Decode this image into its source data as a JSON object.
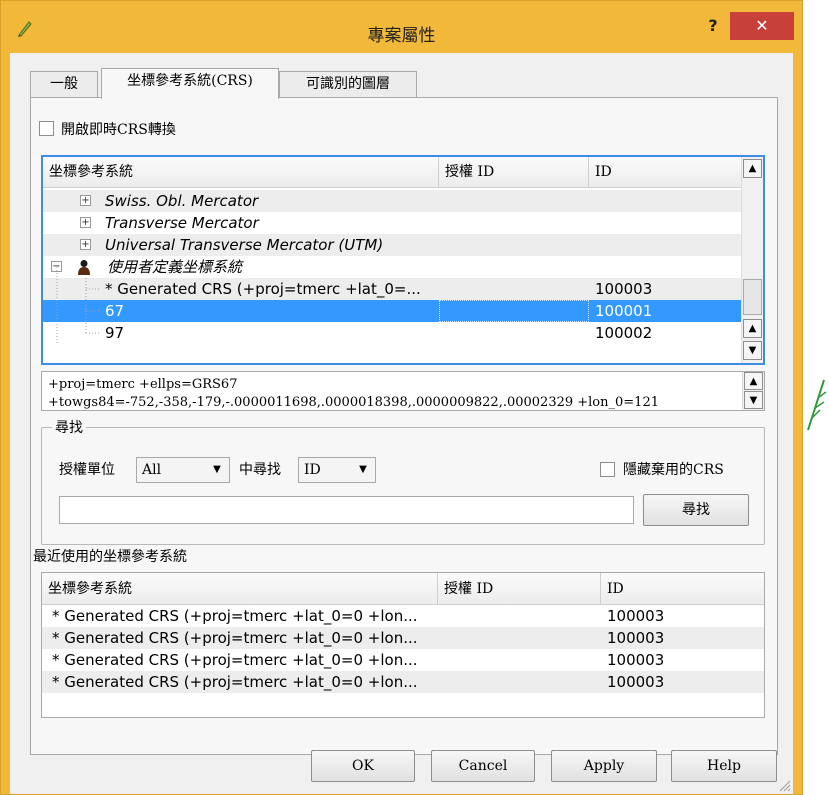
{
  "window": {
    "title": "專案屬性",
    "help_label": "?",
    "close_label": "✕"
  },
  "tabs": [
    {
      "label": "一般",
      "active": false
    },
    {
      "label": "坐標參考系統(CRS)",
      "active": true
    },
    {
      "label": "可識別的圖層",
      "active": false
    }
  ],
  "crs_tab": {
    "otf_checkbox_label": "開啟即時CRS轉換",
    "otf_checked": false,
    "tree": {
      "columns": [
        "坐標參考系統",
        "授權 ID",
        "ID"
      ],
      "rows": [
        {
          "name": "Swiss. Obl. Mercator",
          "auth_id": "",
          "id": "",
          "level": 2,
          "expander": "+",
          "italic": true,
          "selected": false
        },
        {
          "name": "Transverse Mercator",
          "auth_id": "",
          "id": "",
          "level": 2,
          "expander": "+",
          "italic": true,
          "selected": false
        },
        {
          "name": "Universal Transverse Mercator (UTM)",
          "auth_id": "",
          "id": "",
          "level": 2,
          "expander": "+",
          "italic": true,
          "selected": false
        },
        {
          "name": "使用者定義坐標系統",
          "auth_id": "",
          "id": "",
          "level": 1,
          "expander": "−",
          "italic": true,
          "selected": false,
          "user_icon": true
        },
        {
          "name": "* Generated CRS (+proj=tmerc +lat_0=...",
          "auth_id": "",
          "id": "100003",
          "level": 3,
          "expander": "",
          "italic": false,
          "selected": false
        },
        {
          "name": "67",
          "auth_id": "",
          "id": "100001",
          "level": 3,
          "expander": "",
          "italic": false,
          "selected": true
        },
        {
          "name": "97",
          "auth_id": "",
          "id": "100002",
          "level": 3,
          "expander": "",
          "italic": false,
          "selected": false
        }
      ]
    },
    "proj_text": {
      "line1": "+proj=tmerc +ellps=GRS67",
      "line2": "+towgs84=-752,-358,-179,-.0000011698,.0000018398,.0000009822,.00002329 +lon_0=121"
    },
    "search": {
      "group_title": "尋找",
      "authority_label": "授權單位",
      "authority_value": "All",
      "search_in_label": "中尋找",
      "search_in_value": "ID",
      "hide_deprecated_label": "隱藏棄用的CRS",
      "hide_deprecated_checked": false,
      "query": "",
      "find_button": "尋找"
    },
    "recent": {
      "title": "最近使用的坐標參考系統",
      "columns": [
        "坐標參考系統",
        "授權 ID",
        "ID"
      ],
      "rows": [
        {
          "name": "* Generated CRS (+proj=tmerc +lat_0=0 +lon...",
          "auth_id": "",
          "id": "100003"
        },
        {
          "name": "* Generated CRS (+proj=tmerc +lat_0=0 +lon...",
          "auth_id": "",
          "id": "100003"
        },
        {
          "name": "* Generated CRS (+proj=tmerc +lat_0=0 +lon...",
          "auth_id": "",
          "id": "100003"
        },
        {
          "name": "* Generated CRS (+proj=tmerc +lat_0=0 +lon...",
          "auth_id": "",
          "id": "100003"
        }
      ]
    }
  },
  "buttons": {
    "ok": "OK",
    "cancel": "Cancel",
    "apply": "Apply",
    "help": "Help"
  },
  "colors": {
    "title_bar": "#f2b83a",
    "close_button": "#c7413a",
    "selection": "#3399ff",
    "focus_border": "#3d8ee0"
  }
}
